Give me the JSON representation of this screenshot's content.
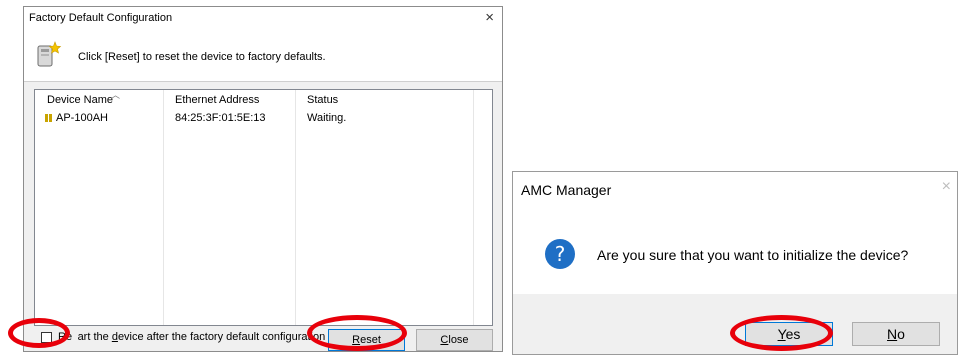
{
  "factory_dialog": {
    "title": "Factory Default Configuration",
    "close_glyph": "×",
    "instruction": "Click [Reset] to reset the device to factory defaults.",
    "columns": [
      "Device Name",
      "Ethernet Address",
      "Status"
    ],
    "rows": [
      {
        "device_name": "AP-100AH",
        "ethernet_address": "84:25:3F:01:5E:13",
        "status": "Waiting."
      }
    ],
    "restart_checkbox": {
      "checked": false,
      "label_pre": "Re",
      "label_post": "art the ",
      "label_ul": "d",
      "label_end": "evice after the factory default configuration"
    },
    "reset_button": {
      "mnemonic": "R",
      "rest": "eset"
    },
    "close_button": {
      "mnemonic": "C",
      "rest": "lose"
    }
  },
  "confirm_dialog": {
    "title": "AMC Manager",
    "close_glyph": "×",
    "icon": "question-icon",
    "question_glyph": "?",
    "message": "Are you sure that you want to initialize the device?",
    "yes_button": {
      "mnemonic": "Y",
      "rest": "es"
    },
    "no_button": {
      "mnemonic": "N",
      "rest": "o"
    }
  },
  "annotations": {
    "highlight_color": "#e8000a",
    "highlighted": [
      "restart-checkbox",
      "reset-button",
      "yes-button"
    ]
  }
}
